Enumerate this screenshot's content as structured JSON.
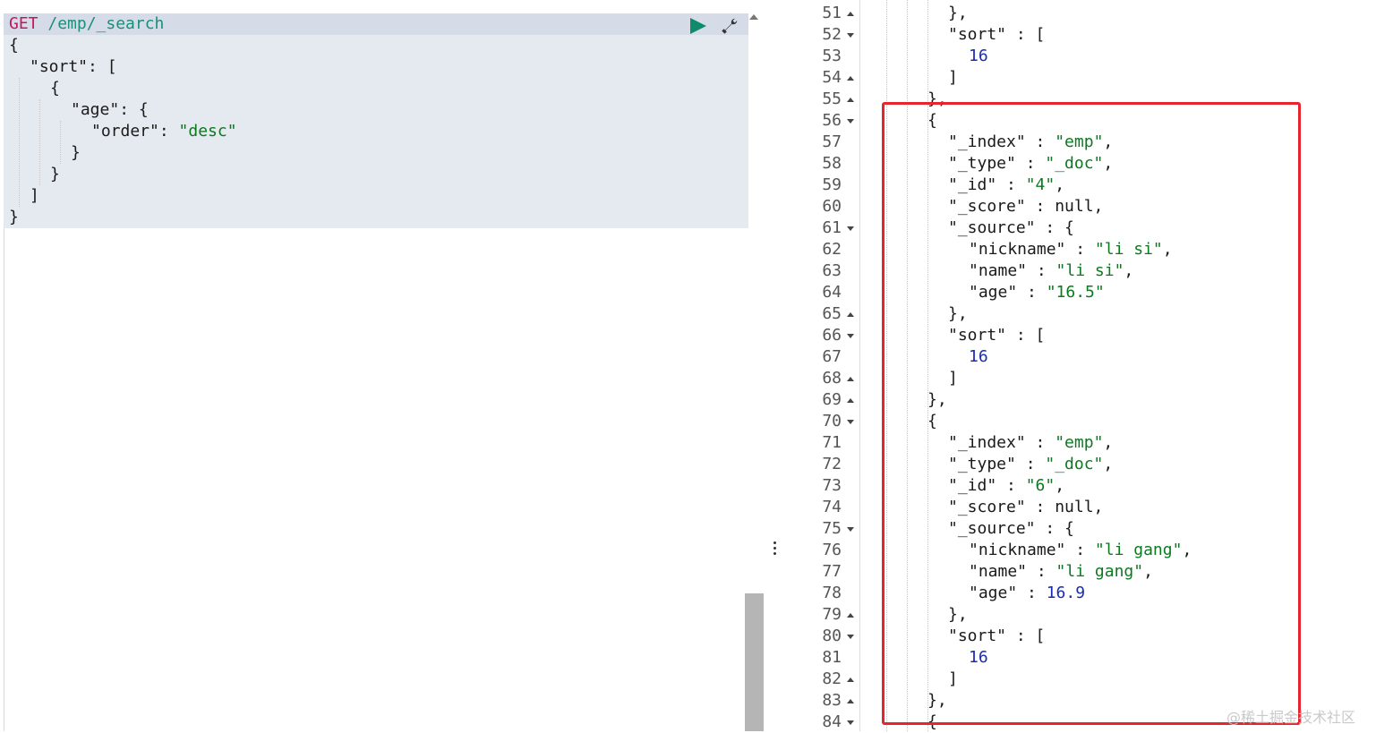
{
  "request": {
    "method": "GET",
    "path": " /emp/_search",
    "body_lines": [
      {
        "indent": 0,
        "parts": [
          {
            "t": "{",
            "c": "key"
          }
        ]
      },
      {
        "indent": 1,
        "parts": [
          {
            "t": "\"sort\"",
            "c": "key"
          },
          {
            "t": ": [",
            "c": "key"
          }
        ]
      },
      {
        "indent": 2,
        "parts": [
          {
            "t": "{",
            "c": "key"
          }
        ]
      },
      {
        "indent": 3,
        "parts": [
          {
            "t": "\"age\"",
            "c": "key"
          },
          {
            "t": ": {",
            "c": "key"
          }
        ]
      },
      {
        "indent": 4,
        "parts": [
          {
            "t": "\"order\"",
            "c": "key"
          },
          {
            "t": ": ",
            "c": "key"
          },
          {
            "t": "\"desc\"",
            "c": "str"
          }
        ]
      },
      {
        "indent": 3,
        "parts": [
          {
            "t": "}",
            "c": "key"
          }
        ]
      },
      {
        "indent": 2,
        "parts": [
          {
            "t": "}",
            "c": "key"
          }
        ]
      },
      {
        "indent": 1,
        "parts": [
          {
            "t": "]",
            "c": "key"
          }
        ]
      },
      {
        "indent": 0,
        "parts": [
          {
            "t": "}",
            "c": "key"
          }
        ]
      }
    ]
  },
  "response": {
    "lines": [
      {
        "n": "51",
        "fold": "up",
        "indent": 4,
        "parts": [
          {
            "t": "},",
            "c": "key"
          }
        ]
      },
      {
        "n": "52",
        "fold": "down",
        "indent": 4,
        "parts": [
          {
            "t": "\"sort\" : [",
            "c": "key"
          }
        ]
      },
      {
        "n": "53",
        "fold": "",
        "indent": 5,
        "parts": [
          {
            "t": "16",
            "c": "num"
          }
        ]
      },
      {
        "n": "54",
        "fold": "up",
        "indent": 4,
        "parts": [
          {
            "t": "]",
            "c": "key"
          }
        ]
      },
      {
        "n": "55",
        "fold": "up",
        "indent": 3,
        "parts": [
          {
            "t": "},",
            "c": "key"
          }
        ]
      },
      {
        "n": "56",
        "fold": "down",
        "indent": 3,
        "parts": [
          {
            "t": "{",
            "c": "key"
          }
        ]
      },
      {
        "n": "57",
        "fold": "",
        "indent": 4,
        "parts": [
          {
            "t": "\"_index\" : ",
            "c": "key"
          },
          {
            "t": "\"emp\"",
            "c": "str"
          },
          {
            "t": ",",
            "c": "key"
          }
        ]
      },
      {
        "n": "58",
        "fold": "",
        "indent": 4,
        "parts": [
          {
            "t": "\"_type\" : ",
            "c": "key"
          },
          {
            "t": "\"_doc\"",
            "c": "str"
          },
          {
            "t": ",",
            "c": "key"
          }
        ]
      },
      {
        "n": "59",
        "fold": "",
        "indent": 4,
        "parts": [
          {
            "t": "\"_id\" : ",
            "c": "key"
          },
          {
            "t": "\"4\"",
            "c": "str"
          },
          {
            "t": ",",
            "c": "key"
          }
        ]
      },
      {
        "n": "60",
        "fold": "",
        "indent": 4,
        "parts": [
          {
            "t": "\"_score\" : null,",
            "c": "key"
          }
        ]
      },
      {
        "n": "61",
        "fold": "down",
        "indent": 4,
        "parts": [
          {
            "t": "\"_source\" : {",
            "c": "key"
          }
        ]
      },
      {
        "n": "62",
        "fold": "",
        "indent": 5,
        "parts": [
          {
            "t": "\"nickname\" : ",
            "c": "key"
          },
          {
            "t": "\"li si\"",
            "c": "str"
          },
          {
            "t": ",",
            "c": "key"
          }
        ]
      },
      {
        "n": "63",
        "fold": "",
        "indent": 5,
        "parts": [
          {
            "t": "\"name\" : ",
            "c": "key"
          },
          {
            "t": "\"li si\"",
            "c": "str"
          },
          {
            "t": ",",
            "c": "key"
          }
        ]
      },
      {
        "n": "64",
        "fold": "",
        "indent": 5,
        "parts": [
          {
            "t": "\"age\" : ",
            "c": "key"
          },
          {
            "t": "\"16.5\"",
            "c": "str"
          }
        ]
      },
      {
        "n": "65",
        "fold": "up",
        "indent": 4,
        "parts": [
          {
            "t": "},",
            "c": "key"
          }
        ]
      },
      {
        "n": "66",
        "fold": "down",
        "indent": 4,
        "parts": [
          {
            "t": "\"sort\" : [",
            "c": "key"
          }
        ]
      },
      {
        "n": "67",
        "fold": "",
        "indent": 5,
        "parts": [
          {
            "t": "16",
            "c": "num"
          }
        ]
      },
      {
        "n": "68",
        "fold": "up",
        "indent": 4,
        "parts": [
          {
            "t": "]",
            "c": "key"
          }
        ]
      },
      {
        "n": "69",
        "fold": "up",
        "indent": 3,
        "parts": [
          {
            "t": "},",
            "c": "key"
          }
        ]
      },
      {
        "n": "70",
        "fold": "down",
        "indent": 3,
        "parts": [
          {
            "t": "{",
            "c": "key"
          }
        ]
      },
      {
        "n": "71",
        "fold": "",
        "indent": 4,
        "parts": [
          {
            "t": "\"_index\" : ",
            "c": "key"
          },
          {
            "t": "\"emp\"",
            "c": "str"
          },
          {
            "t": ",",
            "c": "key"
          }
        ]
      },
      {
        "n": "72",
        "fold": "",
        "indent": 4,
        "parts": [
          {
            "t": "\"_type\" : ",
            "c": "key"
          },
          {
            "t": "\"_doc\"",
            "c": "str"
          },
          {
            "t": ",",
            "c": "key"
          }
        ]
      },
      {
        "n": "73",
        "fold": "",
        "indent": 4,
        "parts": [
          {
            "t": "\"_id\" : ",
            "c": "key"
          },
          {
            "t": "\"6\"",
            "c": "str"
          },
          {
            "t": ",",
            "c": "key"
          }
        ]
      },
      {
        "n": "74",
        "fold": "",
        "indent": 4,
        "parts": [
          {
            "t": "\"_score\" : null,",
            "c": "key"
          }
        ]
      },
      {
        "n": "75",
        "fold": "down",
        "indent": 4,
        "parts": [
          {
            "t": "\"_source\" : {",
            "c": "key"
          }
        ]
      },
      {
        "n": "76",
        "fold": "",
        "indent": 5,
        "parts": [
          {
            "t": "\"nickname\" : ",
            "c": "key"
          },
          {
            "t": "\"li gang\"",
            "c": "str"
          },
          {
            "t": ",",
            "c": "key"
          }
        ]
      },
      {
        "n": "77",
        "fold": "",
        "indent": 5,
        "parts": [
          {
            "t": "\"name\" : ",
            "c": "key"
          },
          {
            "t": "\"li gang\"",
            "c": "str"
          },
          {
            "t": ",",
            "c": "key"
          }
        ]
      },
      {
        "n": "78",
        "fold": "",
        "indent": 5,
        "parts": [
          {
            "t": "\"age\" : ",
            "c": "key"
          },
          {
            "t": "16.9",
            "c": "num"
          }
        ]
      },
      {
        "n": "79",
        "fold": "up",
        "indent": 4,
        "parts": [
          {
            "t": "},",
            "c": "key"
          }
        ]
      },
      {
        "n": "80",
        "fold": "down",
        "indent": 4,
        "parts": [
          {
            "t": "\"sort\" : [",
            "c": "key"
          }
        ]
      },
      {
        "n": "81",
        "fold": "",
        "indent": 5,
        "parts": [
          {
            "t": "16",
            "c": "num"
          }
        ]
      },
      {
        "n": "82",
        "fold": "up",
        "indent": 4,
        "parts": [
          {
            "t": "]",
            "c": "key"
          }
        ]
      },
      {
        "n": "83",
        "fold": "up",
        "indent": 3,
        "parts": [
          {
            "t": "},",
            "c": "key"
          }
        ]
      },
      {
        "n": "84",
        "fold": "down",
        "indent": 3,
        "parts": [
          {
            "t": "{",
            "c": "key"
          }
        ]
      }
    ]
  },
  "icons": {
    "run": "play-icon",
    "settings": "wrench-icon"
  },
  "colors": {
    "highlight": "#e8252f",
    "method": "#c2185b",
    "url": "#1a8f7a",
    "string": "#0b7a1f",
    "number": "#1a2bb0"
  },
  "watermark": "@稀土掘金技术社区"
}
